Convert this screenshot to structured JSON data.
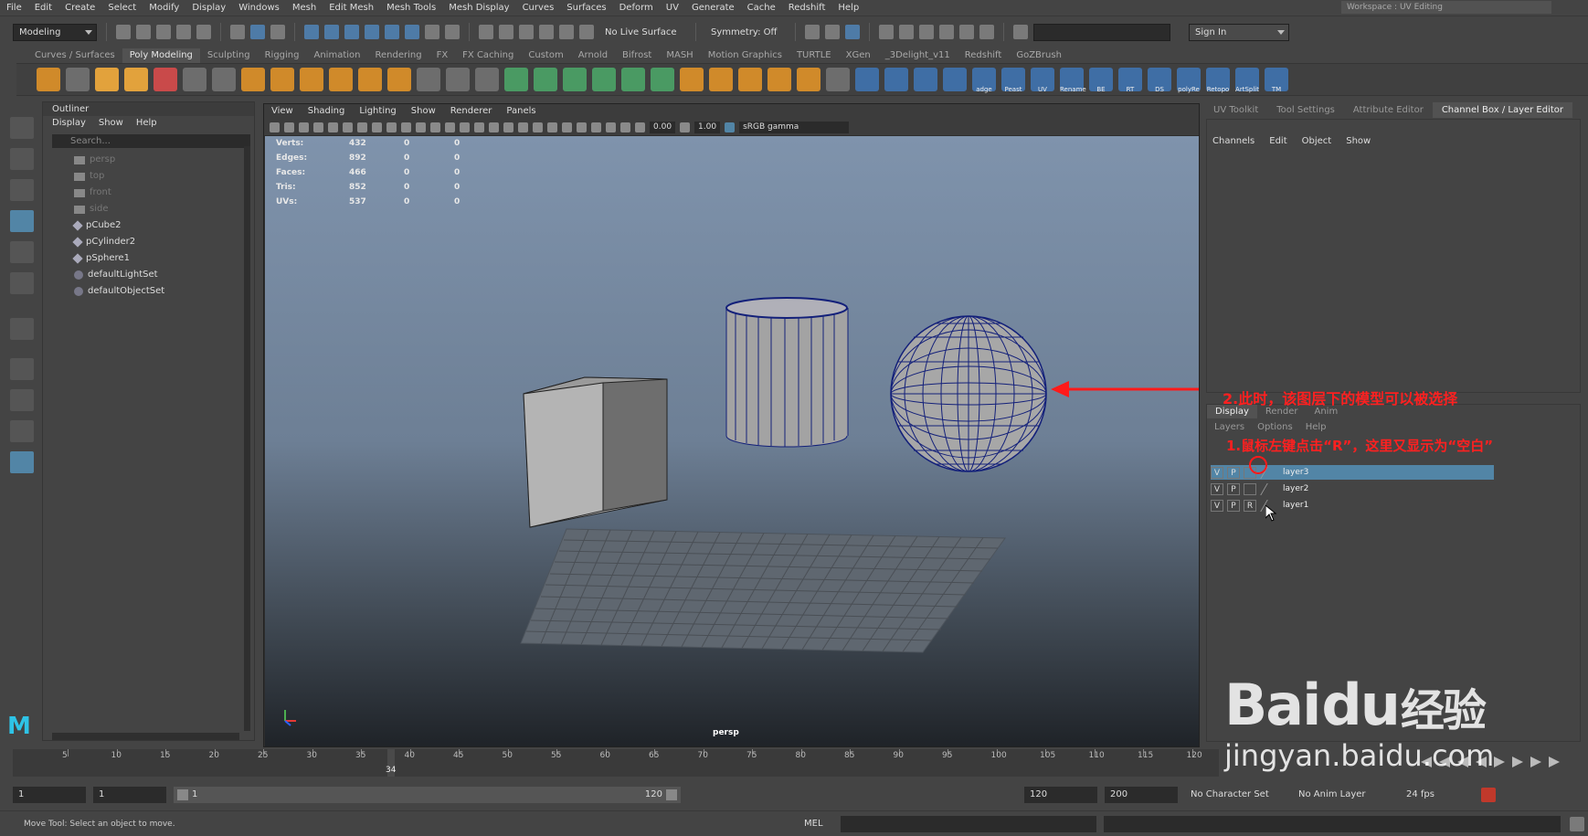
{
  "menubar": [
    "File",
    "Edit",
    "Create",
    "Select",
    "Modify",
    "Display",
    "Windows",
    "Mesh",
    "Edit Mesh",
    "Mesh Tools",
    "Mesh Display",
    "Curves",
    "Surfaces",
    "Deform",
    "UV",
    "Generate",
    "Cache",
    "Redshift",
    "Help"
  ],
  "workspace": {
    "label": "Workspace :",
    "value": "UV Editing"
  },
  "status": {
    "mode": "Modeling",
    "live_surface": "No Live Surface",
    "symmetry": "Symmetry: Off",
    "sign_in": "Sign In"
  },
  "shelf_tabs": [
    "Curves / Surfaces",
    "Poly Modeling",
    "Sculpting",
    "Rigging",
    "Animation",
    "Rendering",
    "FX",
    "FX Caching",
    "Custom",
    "Arnold",
    "Bifrost",
    "MASH",
    "Motion Graphics",
    "TURTLE",
    "XGen",
    "_3Delight_v11",
    "Redshift",
    "GoZBrush"
  ],
  "shelf_active": "Poly Modeling",
  "shelf_labels": [
    "adge",
    "Peast",
    "UV",
    "Rename",
    "BE",
    "RT",
    "DS",
    "polyRe",
    "Retopo",
    "ArtSplit",
    "TM"
  ],
  "outliner": {
    "title": "Outliner",
    "menu": [
      "Display",
      "Show",
      "Help"
    ],
    "search_placeholder": "Search...",
    "items": [
      {
        "label": "persp",
        "dim": true,
        "icon": "camera-icon"
      },
      {
        "label": "top",
        "dim": true,
        "icon": "camera-icon"
      },
      {
        "label": "front",
        "dim": true,
        "icon": "camera-icon"
      },
      {
        "label": "side",
        "dim": true,
        "icon": "camera-icon"
      },
      {
        "label": "pCube2",
        "dim": false,
        "icon": "mesh-icon"
      },
      {
        "label": "pCylinder2",
        "dim": false,
        "icon": "mesh-icon"
      },
      {
        "label": "pSphere1",
        "dim": false,
        "icon": "mesh-icon"
      },
      {
        "label": "defaultLightSet",
        "dim": false,
        "icon": "set-icon"
      },
      {
        "label": "defaultObjectSet",
        "dim": false,
        "icon": "set-icon"
      }
    ]
  },
  "viewport": {
    "menu": [
      "View",
      "Shading",
      "Lighting",
      "Show",
      "Renderer",
      "Panels"
    ],
    "exposure": "0.00",
    "gamma": "1.00",
    "color_space": "sRGB gamma",
    "camera": "persp",
    "hud": [
      {
        "label": "Verts:",
        "v1": "432",
        "v2": "0",
        "v3": "0"
      },
      {
        "label": "Edges:",
        "v1": "892",
        "v2": "0",
        "v3": "0"
      },
      {
        "label": "Faces:",
        "v1": "466",
        "v2": "0",
        "v3": "0"
      },
      {
        "label": "Tris:",
        "v1": "852",
        "v2": "0",
        "v3": "0"
      },
      {
        "label": "UVs:",
        "v1": "537",
        "v2": "0",
        "v3": "0"
      }
    ]
  },
  "right_tabs": [
    "UV Toolkit",
    "Tool Settings",
    "Attribute Editor",
    "Channel Box / Layer Editor"
  ],
  "right_active": "Channel Box / Layer Editor",
  "channel_menu": [
    "Channels",
    "Edit",
    "Object",
    "Show"
  ],
  "layer_tabs": [
    "Display",
    "Render",
    "Anim"
  ],
  "layer_menu": [
    "Layers",
    "Options",
    "Help"
  ],
  "layers": [
    {
      "v": "V",
      "p": "P",
      "r": "",
      "name": "layer3",
      "selected": true
    },
    {
      "v": "V",
      "p": "P",
      "r": "",
      "name": "layer2",
      "selected": false
    },
    {
      "v": "V",
      "p": "P",
      "r": "R",
      "name": "layer1",
      "selected": false
    }
  ],
  "annotations": {
    "a1": "1.鼠标左键点击“R”，这里又显示为“空白”",
    "a2": "2.此时，该图层下的模型可以被选择"
  },
  "timeline": {
    "ticks": [
      "5",
      "10",
      "15",
      "20",
      "25",
      "30",
      "35",
      "40",
      "45",
      "50",
      "55",
      "60",
      "65",
      "70",
      "75",
      "80",
      "85",
      "90",
      "95",
      "100",
      "105",
      "110",
      "115",
      "120"
    ],
    "current_frame": "34",
    "start": "1",
    "start2": "1",
    "range_start": "1",
    "range_end": "120",
    "end": "120",
    "end2": "200",
    "character_set": "No Character Set",
    "anim_layer": "No Anim Layer",
    "fps": "24 fps"
  },
  "status_message": "Move Tool: Select an object to move.",
  "cmd_language": "MEL",
  "watermark": {
    "brand": "Bai",
    "paw": "du",
    "cn": "经验",
    "url": "jingyan.baidu.com"
  }
}
